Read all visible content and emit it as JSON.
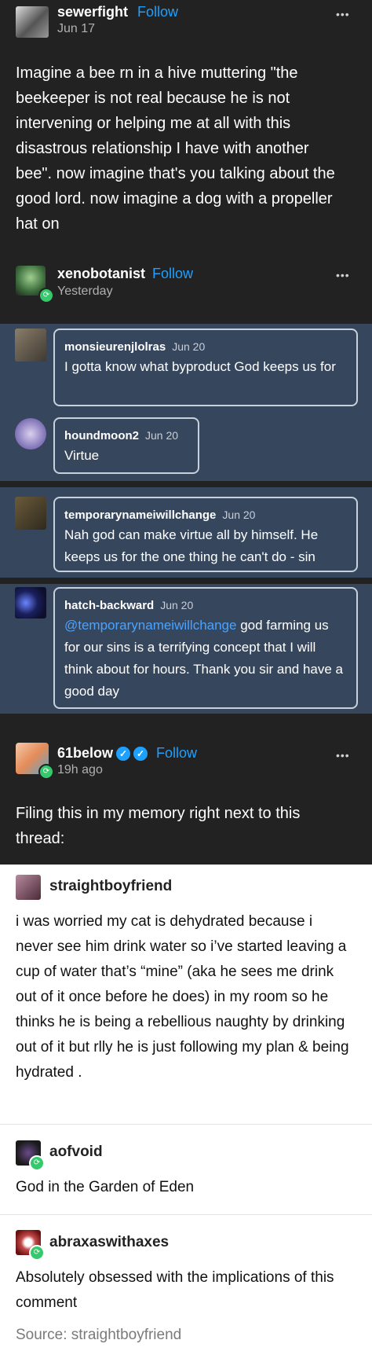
{
  "post1": {
    "username": "sewerfight",
    "follow": "Follow",
    "date": "Jun 17",
    "more": "•••",
    "body": "Imagine a bee rn in a hive muttering \"the beekeeper is not real because he is not intervening or helping me at all with this disastrous relationship I have with another bee\". now imagine that's you talking about the good lord. now imagine a dog with a propeller hat on"
  },
  "post2": {
    "username": "xenobotanist",
    "follow": "Follow",
    "date": "Yesterday",
    "more": "•••",
    "replies": [
      {
        "name": "monsieurenjlolras",
        "date": "Jun 20",
        "text": "I gotta know what byproduct God keeps us for"
      },
      {
        "name": "houndmoon2",
        "date": "Jun 20",
        "text": "Virtue"
      },
      {
        "name": "temporarynameiwillchange",
        "date": "Jun 20",
        "text": "Nah god can make virtue all by himself. He keeps us for the one thing he can't do - sin"
      },
      {
        "name": "hatch-backward",
        "date": "Jun 20",
        "mention": "@temporarynameiwillchange",
        "text": " god farming us for our sins is a terrifying concept that I will think about for hours. Thank you sir and have a good day"
      }
    ]
  },
  "post3": {
    "username": "61below",
    "follow": "Follow",
    "date": "19h ago",
    "more": "•••",
    "body": "Filing this in my memory right next to this thread:"
  },
  "embedded": {
    "posts": [
      {
        "name": "straightboyfriend",
        "text": "i was worried my cat is dehydrated because i never see him drink water so i’ve started leaving a cup of water that’s “mine” (aka he sees me drink out of it once before he does) in my room so he thinks he is being a rebellious naughty by drinking out of it but rlly he is just following my plan & being hydrated ."
      },
      {
        "name": "aofvoid",
        "text": "God in the Garden of Eden"
      },
      {
        "name": "abraxaswithaxes",
        "text": "Absolutely obsessed with the implications of this comment"
      }
    ],
    "source": "Source: straightboyfriend"
  },
  "colors": {
    "accent": "#1ea0ff",
    "slate": "#36465d",
    "reblog": "#35c96b"
  }
}
